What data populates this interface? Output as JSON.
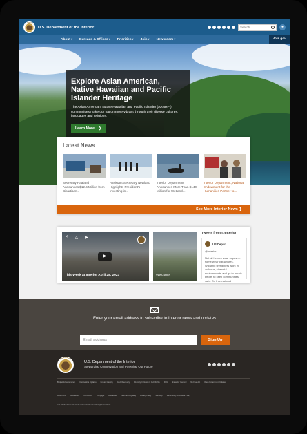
{
  "header": {
    "department": "U.S. Department of the Interior",
    "search_placeholder": "Search",
    "nav": [
      "About",
      "Bureaus & Offices",
      "Priorities",
      "Join",
      "Newsroom"
    ],
    "vote": "Vote.gov"
  },
  "hero": {
    "title": "Explore Asian American, Native Hawaiian and Pacific Islander Heritage",
    "text": "The Asian American, Native Hawaiian and Pacific Islander (AANHPI) communities make our nation more vibrant through their diverse cultures, languages and religions.",
    "button": "Learn More"
  },
  "news": {
    "heading": "Latest News",
    "items": [
      {
        "caption": "Secretary Haaland Announces $12.6 Million from Bipartisan..."
      },
      {
        "caption": "Assistant Secretary Newland Highlights President's Investing in..."
      },
      {
        "caption": "Interior Department Announces More Than $140 Million for Wetland..."
      },
      {
        "caption": "Interior Department, National Endowment for the Humanities Partner to..."
      }
    ],
    "more": "See More Interior News"
  },
  "media": {
    "video_title": "This Week at Interior April 28, 2023",
    "photo_caption": "Welcome",
    "tweets_heading": "Tweets from @Interior",
    "tweet_user": "US Depar...",
    "tweet_handle": "@Interior",
    "tweet_text": "Not all heroes wear capes — some wear parachutes. Wildland firefighters work in arduous, stressful environments and go to heroic efforts to keep communities safe. On International"
  },
  "subscribe": {
    "text": "Enter your email address to subscribe to Interior news and updates",
    "placeholder": "Email address",
    "button": "Sign Up"
  },
  "footer": {
    "name": "U.S. Department of the Interior",
    "tagline": "Stewarding Conservation and Powering Our Future",
    "links_1": [
      "Budget & Performance",
      "Coronavirus Updates",
      "Ensure Integrity",
      "Covid Recovery",
      "Diversity, Inclusion & Civil Rights",
      "FOIA",
      "Inspector General",
      "No Fear Act",
      "Open Government Initiative"
    ],
    "links_2": [
      "About DOI",
      "Accessibility",
      "Contact Us",
      "Copyright",
      "Disclaimer",
      "Information Quality",
      "Privacy Policy",
      "Site Map",
      "Vulnerability Disclosure Policy"
    ],
    "copyright": "U.S. Department of the Interior  1849 C Street NW  Washington DC 20240"
  }
}
